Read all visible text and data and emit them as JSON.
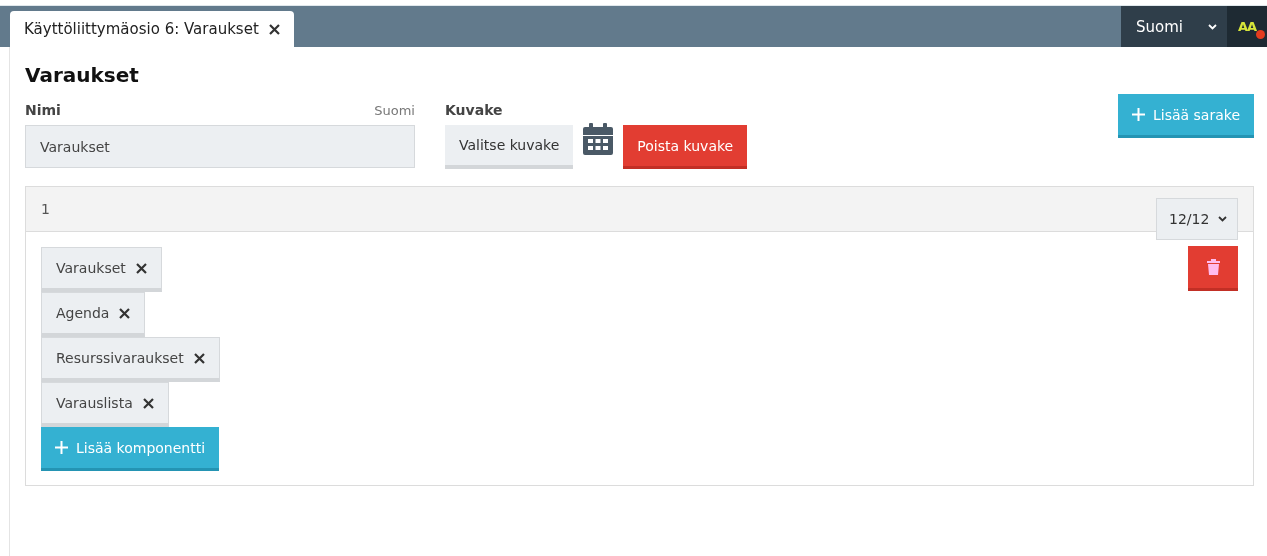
{
  "tabs": [
    {
      "label": "Käyttöliittymäosio 6: Varaukset",
      "selected": true
    }
  ],
  "language": {
    "value": "Suomi"
  },
  "user": {
    "initials": "AA",
    "online": true
  },
  "page_title": "Varaukset",
  "name_field": {
    "label": "Nimi",
    "language": "Suomi",
    "value": "Varaukset"
  },
  "icon_field": {
    "label": "Kuvake",
    "choose_button": "Valitse kuvake",
    "remove_button": "Poista kuvake"
  },
  "add_column_button": "Lisää sarake",
  "columns": [
    {
      "title": "1",
      "width": "12/12",
      "components": [
        {
          "label": "Varaukset"
        },
        {
          "label": "Agenda"
        },
        {
          "label": "Resurssivaraukset"
        },
        {
          "label": "Varauslista"
        }
      ],
      "add_component_button": "Lisää komponentti"
    }
  ]
}
